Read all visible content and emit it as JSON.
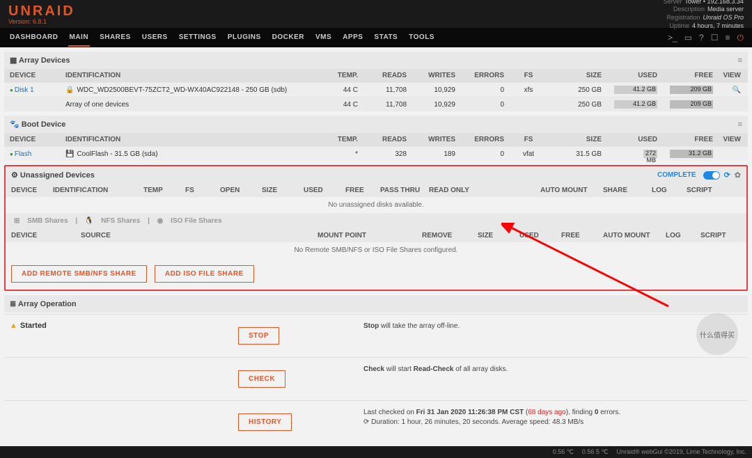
{
  "brand": "UNRAID",
  "version": "Version: 6.8.1",
  "sys": {
    "server_lbl": "Server",
    "server_val": "Tower • 192.168.3.34",
    "desc_lbl": "Description",
    "desc_val": "Media server",
    "reg_lbl": "Registration",
    "reg_val": "Unraid OS Pro",
    "uptime_lbl": "Uptime",
    "uptime_val": "4 hours, 7 minutes"
  },
  "nav": [
    "DASHBOARD",
    "MAIN",
    "SHARES",
    "USERS",
    "SETTINGS",
    "PLUGINS",
    "DOCKER",
    "VMS",
    "APPS",
    "STATS",
    "TOOLS"
  ],
  "nav_active": "MAIN",
  "array": {
    "title": "Array Devices",
    "cols": {
      "device": "DEVICE",
      "id": "IDENTIFICATION",
      "temp": "TEMP.",
      "reads": "READS",
      "writes": "WRITES",
      "errors": "ERRORS",
      "fs": "FS",
      "size": "SIZE",
      "used": "USED",
      "free": "FREE",
      "view": "VIEW"
    },
    "row": {
      "name": "Disk 1",
      "id": "WDC_WD2500BEVT-75ZCT2_WD-WX40AC922148 - 250 GB (sdb)",
      "temp": "44 C",
      "reads": "11,708",
      "writes": "10,929",
      "errors": "0",
      "fs": "xfs",
      "size": "250 GB",
      "used": "41.2 GB",
      "free": "209 GB"
    },
    "sum": {
      "label": "Array of one devices",
      "temp": "44 C",
      "reads": "11,708",
      "writes": "10,929",
      "errors": "0",
      "size": "250 GB",
      "used": "41.2 GB",
      "free": "209 GB"
    }
  },
  "boot": {
    "title": "Boot Device",
    "row": {
      "name": "Flash",
      "id": "CoolFlash - 31.5 GB (sda)",
      "temp": "*",
      "reads": "328",
      "writes": "189",
      "errors": "0",
      "fs": "vfat",
      "size": "31.5 GB",
      "used": "272 MB",
      "free": "31.2 GB"
    }
  },
  "ud": {
    "title": "Unassigned Devices",
    "complete": "COMPLETE",
    "cols": {
      "device": "DEVICE",
      "id": "IDENTIFICATION",
      "temp": "TEMP",
      "fs": "FS",
      "open": "OPEN",
      "size": "SIZE",
      "used": "USED",
      "free": "FREE",
      "pass": "PASS THRU",
      "ro": "READ ONLY",
      "am": "AUTO MOUNT",
      "share": "SHARE",
      "log": "LOG",
      "script": "SCRIPT"
    },
    "empty": "No unassigned disks available."
  },
  "shares": {
    "tabs": {
      "smb": "SMB Shares",
      "nfs": "NFS Shares",
      "iso": "ISO File Shares"
    },
    "cols": {
      "device": "DEVICE",
      "source": "SOURCE",
      "mp": "MOUNT POINT",
      "remove": "REMOVE",
      "size": "SIZE",
      "used": "USED",
      "free": "FREE",
      "am": "AUTO MOUNT",
      "log": "LOG",
      "script": "SCRIPT"
    },
    "empty": "No Remote SMB/NFS or ISO File Shares configured.",
    "btn1": "ADD REMOTE SMB/NFS SHARE",
    "btn2": "ADD ISO FILE SHARE"
  },
  "ops": {
    "title": "Array Operation",
    "started": "Started",
    "stop_btn": "STOP",
    "stop_desc_a": "Stop",
    "stop_desc_b": " will take the array off-line.",
    "check_btn": "CHECK",
    "check_desc_a": "Check",
    "check_desc_b": " will start ",
    "check_desc_c": "Read-Check",
    "check_desc_d": " of all array disks.",
    "hist_btn": "HISTORY",
    "hist_line1a": "Last checked on ",
    "hist_line1b": "Fri 31 Jan 2020 11:26:38 PM CST",
    "hist_line1c": " (",
    "hist_days": "68 days ago",
    "hist_line1d": "), finding ",
    "hist_err": "0",
    "hist_line1e": " errors.",
    "hist_line2": "⟳ Duration: 1 hour, 26 minutes, 20 seconds. Average speed: 48.3 MB/s"
  },
  "footer": {
    "t1": "0.56 ℃",
    "t2": "0.56 5 ℃",
    "t3": "Unraid® webGui ©2019, Lime Technology, Inc."
  },
  "watermark": "什么值得买"
}
